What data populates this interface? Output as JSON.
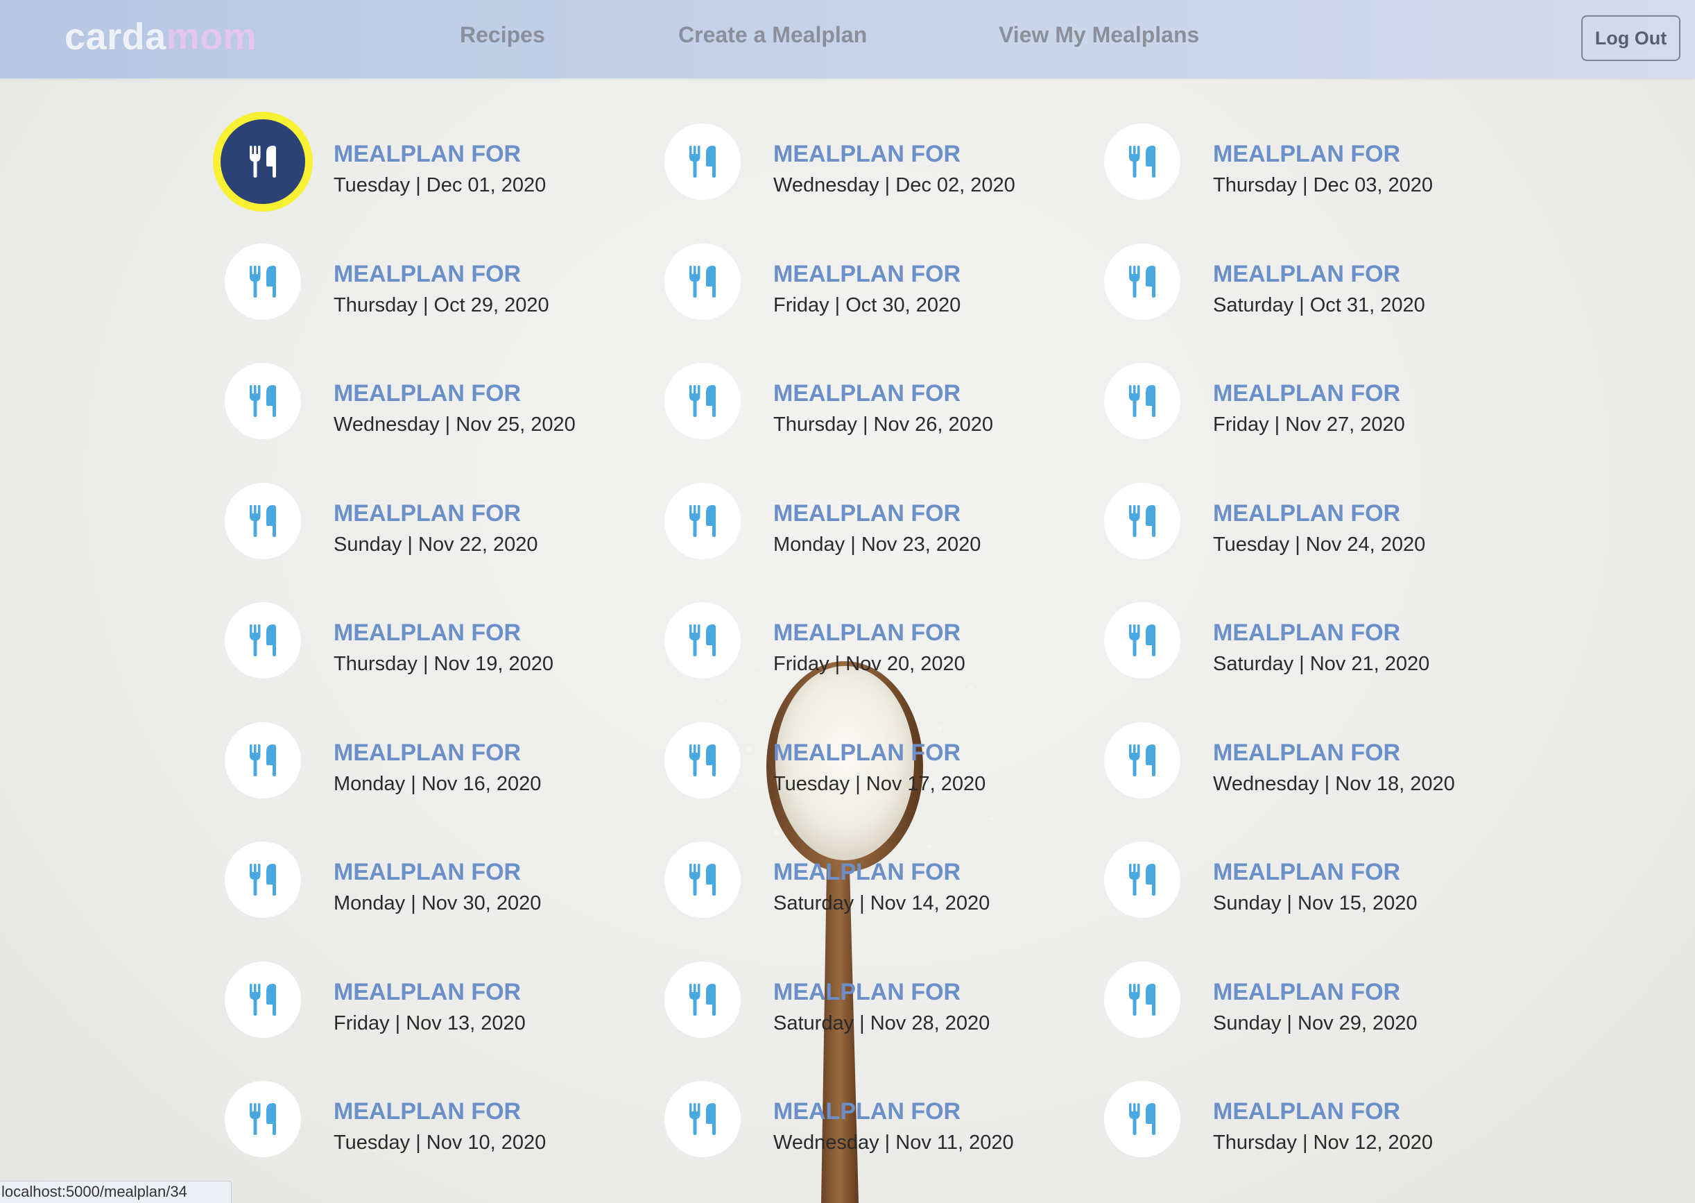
{
  "nav": {
    "brand_part1": "carda",
    "brand_part2": "mom",
    "recipes": "Recipes",
    "create": "Create a Mealplan",
    "view": "View My Mealplans",
    "logout": "Log Out"
  },
  "item_title": "MEALPLAN FOR",
  "mealplans": [
    {
      "date": "Tuesday | Dec 01, 2020",
      "highlighted": true
    },
    {
      "date": "Wednesday | Dec 02, 2020"
    },
    {
      "date": "Thursday | Dec 03, 2020"
    },
    {
      "date": "Thursday | Oct 29, 2020"
    },
    {
      "date": "Friday | Oct 30, 2020"
    },
    {
      "date": "Saturday | Oct 31, 2020"
    },
    {
      "date": "Wednesday | Nov 25, 2020"
    },
    {
      "date": "Thursday | Nov 26, 2020"
    },
    {
      "date": "Friday | Nov 27, 2020"
    },
    {
      "date": "Sunday | Nov 22, 2020"
    },
    {
      "date": "Monday | Nov 23, 2020"
    },
    {
      "date": "Tuesday | Nov 24, 2020"
    },
    {
      "date": "Thursday | Nov 19, 2020"
    },
    {
      "date": "Friday | Nov 20, 2020"
    },
    {
      "date": "Saturday | Nov 21, 2020"
    },
    {
      "date": "Monday | Nov 16, 2020"
    },
    {
      "date": "Tuesday | Nov 17, 2020"
    },
    {
      "date": "Wednesday | Nov 18, 2020"
    },
    {
      "date": "Monday | Nov 30, 2020"
    },
    {
      "date": "Saturday | Nov 14, 2020"
    },
    {
      "date": "Sunday | Nov 15, 2020"
    },
    {
      "date": "Friday | Nov 13, 2020"
    },
    {
      "date": "Saturday | Nov 28, 2020"
    },
    {
      "date": "Sunday | Nov 29, 2020"
    },
    {
      "date": "Tuesday | Nov 10, 2020"
    },
    {
      "date": "Wednesday | Nov 11, 2020"
    },
    {
      "date": "Thursday | Nov 12, 2020"
    }
  ],
  "status_url": "localhost:5000/mealplan/34",
  "icon": "utensils-icon",
  "colors": {
    "nav_bg": "#c7d3e9",
    "brand_light": "#eef1f8",
    "brand_pink": "#e4c6ef",
    "title_blue": "#6a8fc9",
    "icon_blue": "#4aa8e0",
    "active_circle": "#2c4277",
    "highlight_ring": "#f7f033"
  }
}
